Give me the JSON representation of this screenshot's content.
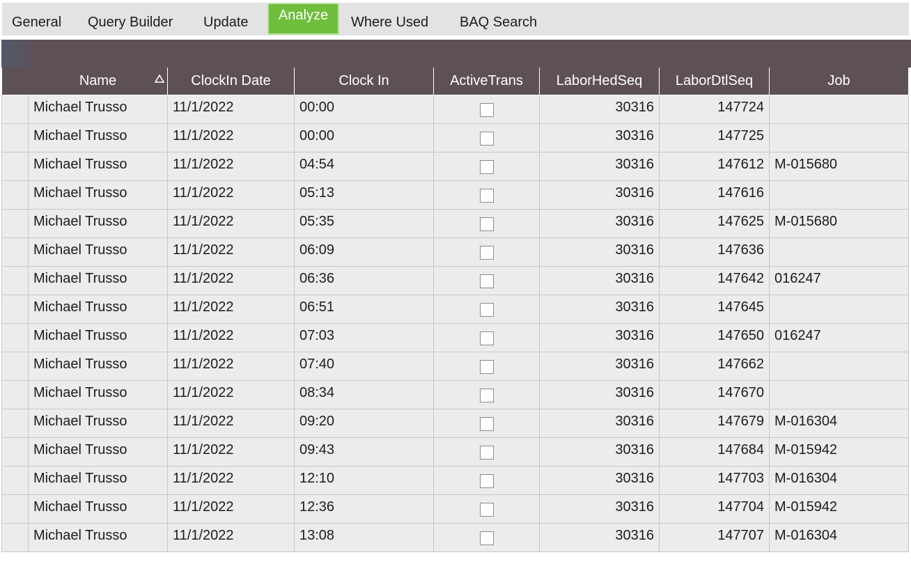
{
  "tabs": [
    {
      "label": "General",
      "active": false
    },
    {
      "label": "Query Builder",
      "active": false
    },
    {
      "label": "Update",
      "active": false
    },
    {
      "label": "Analyze",
      "active": true
    },
    {
      "label": "Where Used",
      "active": false
    },
    {
      "label": "BAQ Search",
      "active": false
    }
  ],
  "colors": {
    "header_bg": "#5d5155",
    "active_tab": "#6fbe3c",
    "row_bg": "#ececec"
  },
  "grid": {
    "columns": [
      "Name",
      "ClockIn Date",
      "Clock In",
      "ActiveTrans",
      "LaborHedSeq",
      "LaborDtlSeq",
      "Job"
    ],
    "sort": {
      "column": "Name",
      "direction": "ascending",
      "icon": "sort-ascending-icon"
    },
    "rows": [
      {
        "name": "Michael Trusso",
        "date": "11/1/2022",
        "clock_in": "00:00",
        "active": false,
        "hed": "30316",
        "dtl": "147724",
        "job": ""
      },
      {
        "name": "Michael Trusso",
        "date": "11/1/2022",
        "clock_in": "00:00",
        "active": false,
        "hed": "30316",
        "dtl": "147725",
        "job": ""
      },
      {
        "name": "Michael Trusso",
        "date": "11/1/2022",
        "clock_in": "04:54",
        "active": false,
        "hed": "30316",
        "dtl": "147612",
        "job": "M-015680"
      },
      {
        "name": "Michael Trusso",
        "date": "11/1/2022",
        "clock_in": "05:13",
        "active": false,
        "hed": "30316",
        "dtl": "147616",
        "job": ""
      },
      {
        "name": "Michael Trusso",
        "date": "11/1/2022",
        "clock_in": "05:35",
        "active": false,
        "hed": "30316",
        "dtl": "147625",
        "job": "M-015680"
      },
      {
        "name": "Michael Trusso",
        "date": "11/1/2022",
        "clock_in": "06:09",
        "active": false,
        "hed": "30316",
        "dtl": "147636",
        "job": ""
      },
      {
        "name": "Michael Trusso",
        "date": "11/1/2022",
        "clock_in": "06:36",
        "active": false,
        "hed": "30316",
        "dtl": "147642",
        "job": "016247"
      },
      {
        "name": "Michael Trusso",
        "date": "11/1/2022",
        "clock_in": "06:51",
        "active": false,
        "hed": "30316",
        "dtl": "147645",
        "job": ""
      },
      {
        "name": "Michael Trusso",
        "date": "11/1/2022",
        "clock_in": "07:03",
        "active": false,
        "hed": "30316",
        "dtl": "147650",
        "job": "016247"
      },
      {
        "name": "Michael Trusso",
        "date": "11/1/2022",
        "clock_in": "07:40",
        "active": false,
        "hed": "30316",
        "dtl": "147662",
        "job": ""
      },
      {
        "name": "Michael Trusso",
        "date": "11/1/2022",
        "clock_in": "08:34",
        "active": false,
        "hed": "30316",
        "dtl": "147670",
        "job": ""
      },
      {
        "name": "Michael Trusso",
        "date": "11/1/2022",
        "clock_in": "09:20",
        "active": false,
        "hed": "30316",
        "dtl": "147679",
        "job": "M-016304"
      },
      {
        "name": "Michael Trusso",
        "date": "11/1/2022",
        "clock_in": "09:43",
        "active": false,
        "hed": "30316",
        "dtl": "147684",
        "job": "M-015942"
      },
      {
        "name": "Michael Trusso",
        "date": "11/1/2022",
        "clock_in": "12:10",
        "active": false,
        "hed": "30316",
        "dtl": "147703",
        "job": "M-016304"
      },
      {
        "name": "Michael Trusso",
        "date": "11/1/2022",
        "clock_in": "12:36",
        "active": false,
        "hed": "30316",
        "dtl": "147704",
        "job": "M-015942"
      },
      {
        "name": "Michael Trusso",
        "date": "11/1/2022",
        "clock_in": "13:08",
        "active": false,
        "hed": "30316",
        "dtl": "147707",
        "job": "M-016304"
      }
    ]
  }
}
